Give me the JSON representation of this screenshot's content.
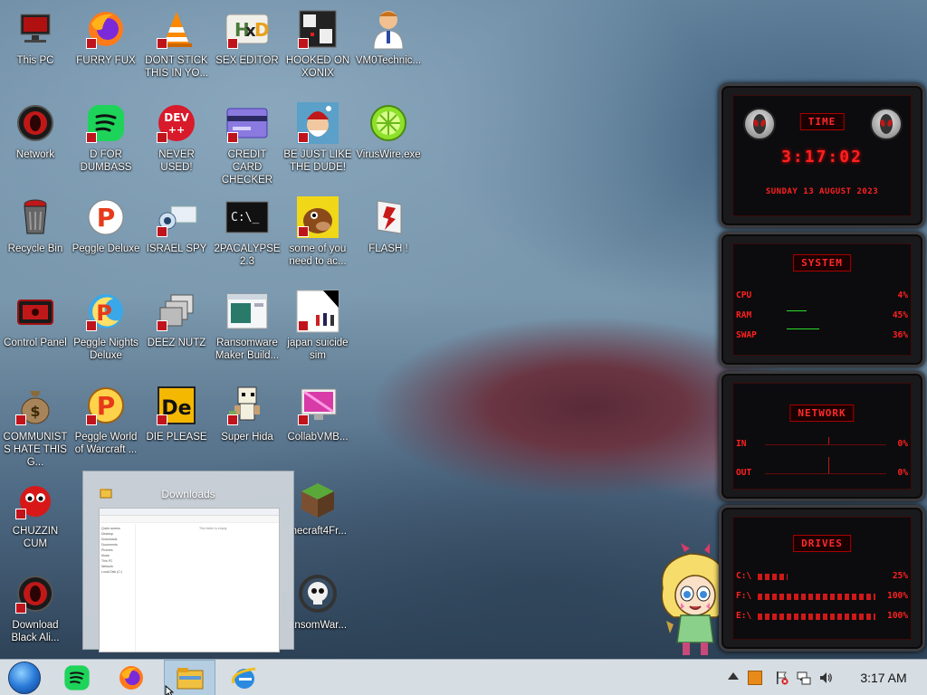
{
  "desktop": {
    "icons": [
      {
        "label": "This PC",
        "icon": "computer-icon"
      },
      {
        "label": "FURRY FUX",
        "icon": "firefox-icon"
      },
      {
        "label": "DONT STICK THIS IN YO...",
        "icon": "vlc-icon"
      },
      {
        "label": "SEX EDITOR",
        "icon": "hxd-icon"
      },
      {
        "label": "HOOKED ON XONIX",
        "icon": "xonix-icon"
      },
      {
        "label": "VM0Technic...",
        "icon": "doctor-icon"
      },
      {
        "label": "Network",
        "icon": "alien-network-icon"
      },
      {
        "label": "D FOR DUMBASS",
        "icon": "spotify-like-icon"
      },
      {
        "label": "NEVER USED!",
        "icon": "devcpp-icon"
      },
      {
        "label": "CREDIT CARD CHECKER",
        "icon": "credit-card-icon"
      },
      {
        "label": "BE JUST LIKE THE DUDE!",
        "icon": "santa-icon"
      },
      {
        "label": "VirusWire.exe",
        "icon": "limewire-icon"
      },
      {
        "label": "Recycle Bin",
        "icon": "recycle-bin-icon"
      },
      {
        "label": "Peggle Deluxe",
        "icon": "peggle-icon"
      },
      {
        "label": "ISRAEL SPY",
        "icon": "spy-icon"
      },
      {
        "label": "2PACALYPSE 2.3",
        "icon": "terminal-icon"
      },
      {
        "label": "some of you need to ac...",
        "icon": "dog-icon"
      },
      {
        "label": "FLASH !",
        "icon": "flash-icon"
      },
      {
        "label": "Control Panel",
        "icon": "control-panel-icon"
      },
      {
        "label": "Peggle Nights Deluxe",
        "icon": "peggle-nights-icon"
      },
      {
        "label": "DEEZ NUTZ",
        "icon": "stack-icon"
      },
      {
        "label": "Ransomware Maker Build...",
        "icon": "window-icon"
      },
      {
        "label": "japan suicide sim",
        "icon": "japan-sim-icon"
      },
      {
        "label": "COMMUNISTS HATE THIS G...",
        "icon": "money-bag-icon"
      },
      {
        "label": "Peggle World of Warcraft ...",
        "icon": "peggle-wow-icon"
      },
      {
        "label": "DIE PLEASE",
        "icon": "de-icon"
      },
      {
        "label": "Super Hida",
        "icon": "pixel-character-icon"
      },
      {
        "label": "CollabVMB...",
        "icon": "monitor-icon"
      },
      {
        "label": "CHUZZIN CUM",
        "icon": "chuzzle-icon"
      },
      {
        "label": "inecraft4Fr...",
        "icon": "minecraft-icon"
      },
      {
        "label": "Download Black Ali...",
        "icon": "alien-download-icon"
      },
      {
        "label": "ansomWar...",
        "icon": "skull-icon"
      }
    ]
  },
  "thumbnail": {
    "title": "Downloads",
    "sidebar": [
      "Quick access",
      "Desktop",
      "Downloads",
      "Documents",
      "Pictures",
      "Music",
      "This PC",
      "Network",
      "Local Disk (C:)"
    ],
    "empty_text": "This folder is empty."
  },
  "widget": {
    "time": {
      "title": "TIME",
      "clock": "3:17:02",
      "date": "SUNDAY 13 AUGUST 2023"
    },
    "system": {
      "title": "SYSTEM",
      "rows": [
        {
          "key": "CPU",
          "value": "4%",
          "level": 0.04
        },
        {
          "key": "RAM",
          "value": "45%",
          "level": 0.45
        },
        {
          "key": "SWAP",
          "value": "36%",
          "level": 0.36
        }
      ]
    },
    "network": {
      "title": "NETWORK",
      "rows": [
        {
          "key": "IN",
          "value": "0%"
        },
        {
          "key": "OUT",
          "value": "0%"
        }
      ]
    },
    "drives": {
      "title": "DRIVES",
      "rows": [
        {
          "key": "C:\\",
          "value": "25%",
          "level": 0.25
        },
        {
          "key": "F:\\",
          "value": "100%",
          "level": 1.0
        },
        {
          "key": "E:\\",
          "value": "100%",
          "level": 1.0
        }
      ]
    }
  },
  "taskbar": {
    "clock": "3:17 AM",
    "buttons": [
      "start-orb",
      "spotify-like",
      "firefox",
      "file-explorer",
      "internet-explorer"
    ]
  }
}
